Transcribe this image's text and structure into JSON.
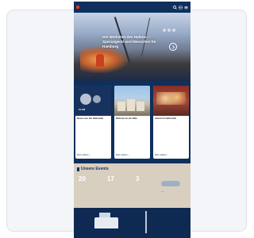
{
  "brand": {
    "logo_text": "",
    "accent_color": "#e3342f",
    "primary_color": "#0f2f5c"
  },
  "topbar": {
    "icons": [
      "search-icon",
      "globe-icon",
      "menu-icon"
    ]
  },
  "hero": {
    "headline": "Die Werkstatt des Hafens — Spezialgerät und Menschen für Hamburg"
  },
  "news": {
    "cards": [
      {
        "title": "Neues aus der Hafenwelt",
        "subtitle": "",
        "more_label": "Mehr erfahren"
      },
      {
        "title": "Wohnen an der Elbe",
        "subtitle": "",
        "more_label": "Mehr erfahren"
      },
      {
        "title": "Abend im Hafenclub",
        "subtitle": "",
        "more_label": "Mehr erfahren"
      }
    ],
    "image_badge_text": "CLUB"
  },
  "events": {
    "title": "Unsere Events",
    "items": [
      {
        "day": "20",
        "month": "",
        "desc": ""
      },
      {
        "day": "17",
        "month": "",
        "desc": ""
      },
      {
        "day": "3",
        "month": "",
        "desc": ""
      }
    ]
  }
}
